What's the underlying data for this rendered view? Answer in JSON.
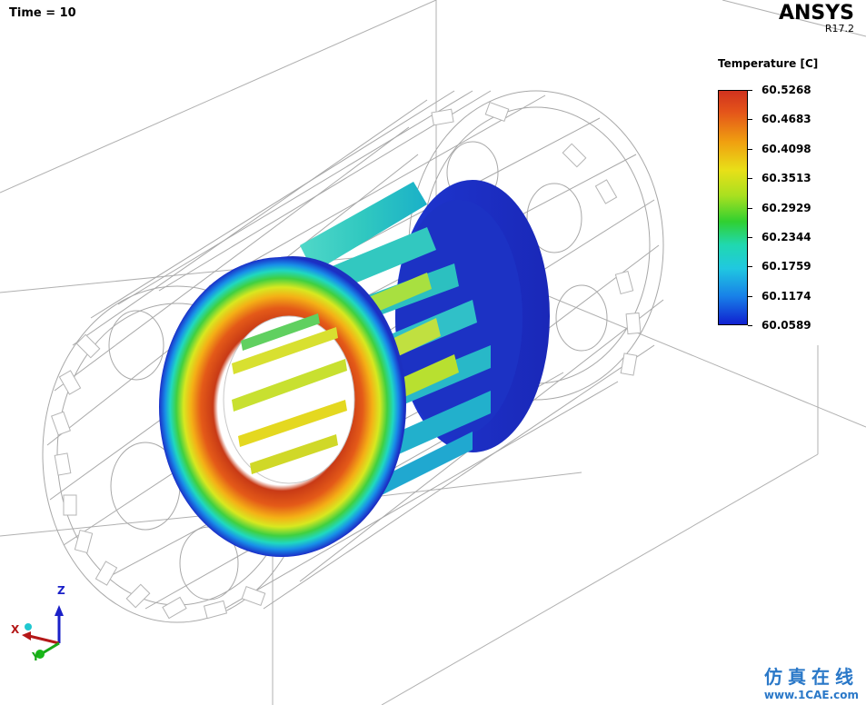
{
  "viewport": {
    "time_label": "Time = 10",
    "brand": {
      "name": "ANSYS",
      "release": "R17.2"
    }
  },
  "legend": {
    "title": "Temperature [C]",
    "values": [
      "60.5268",
      "60.4683",
      "60.4098",
      "60.3513",
      "60.2929",
      "60.2344",
      "60.1759",
      "60.1174",
      "60.0589"
    ],
    "colors": [
      "#d0321e",
      "#f0a010",
      "#e8e018",
      "#a8e020",
      "#30d030",
      "#20d8b0",
      "#20c8e0",
      "#1880e8",
      "#1020d0"
    ]
  },
  "triad": {
    "z_label": "Z",
    "x_label": "X",
    "y_label": "Y"
  },
  "watermark": {
    "chinese": "仿真在线",
    "url": "www.1CAE.com"
  }
}
